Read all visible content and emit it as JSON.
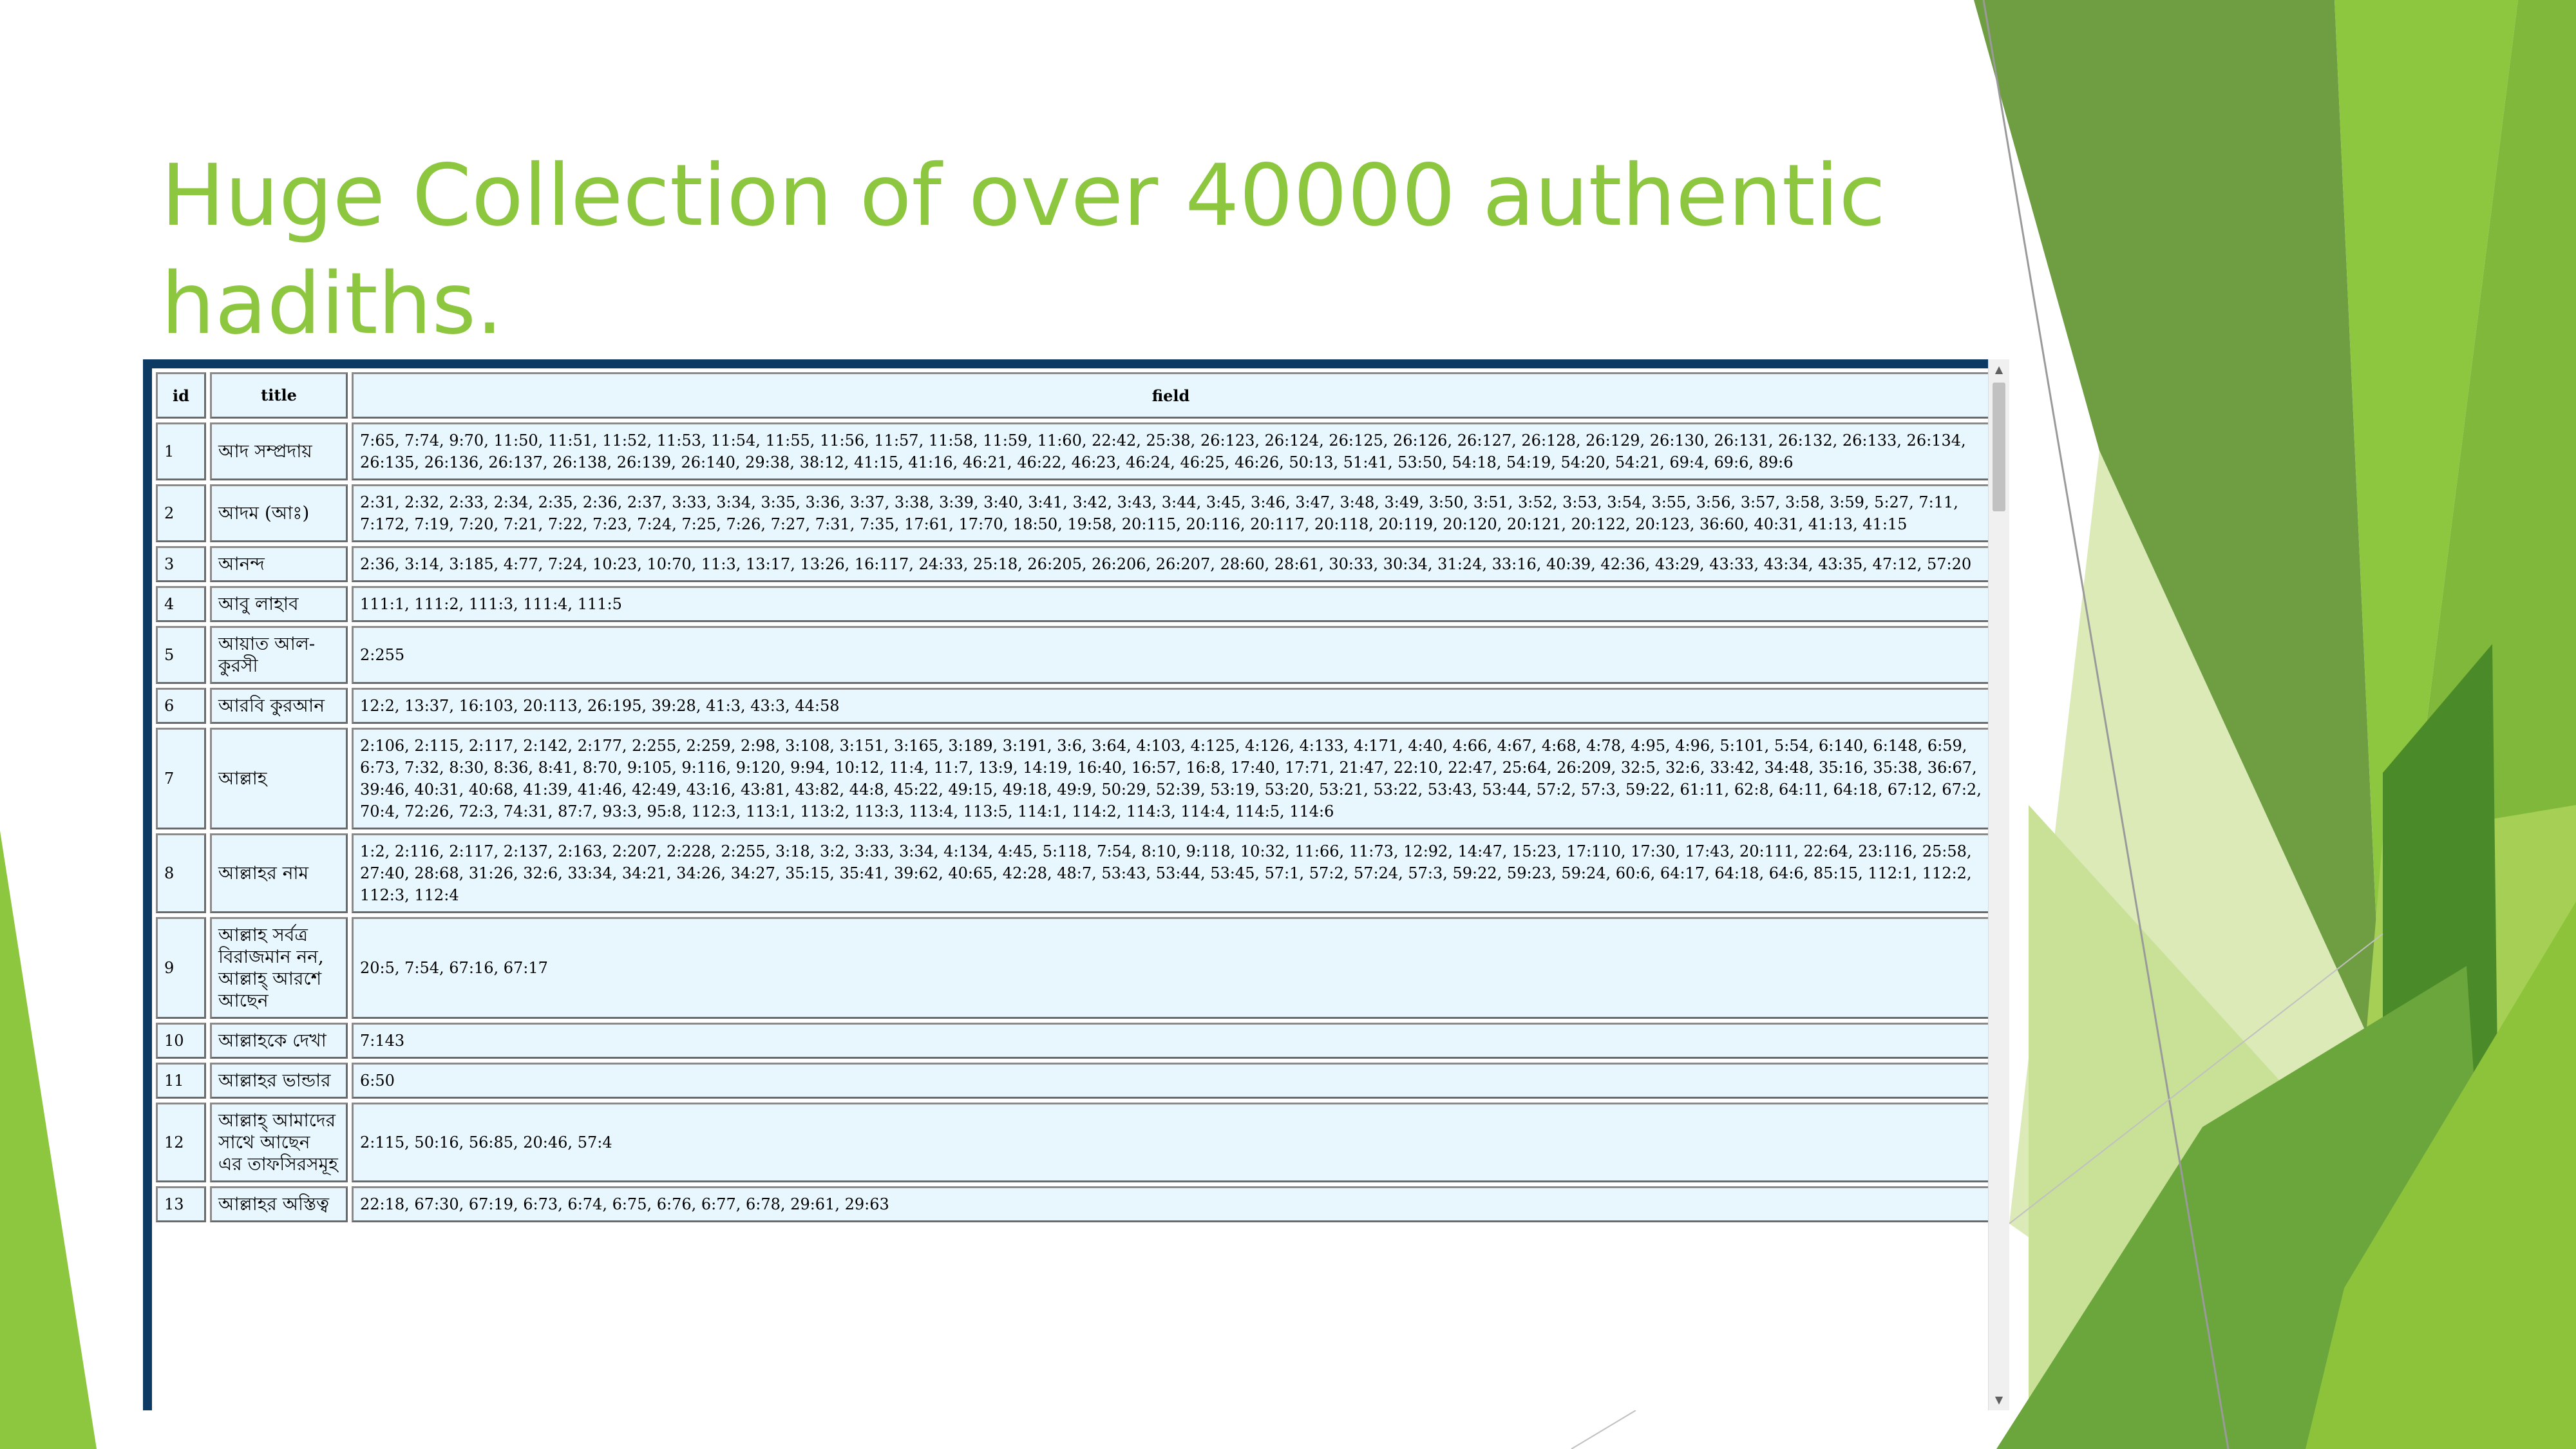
{
  "slide": {
    "title_line1": "Huge Collection of over 40000 authentic",
    "title_line2": "hadiths.",
    "accent_colors": [
      "#8dc63f",
      "#6fa53a",
      "#5e9233",
      "#dfeebf",
      "#a7cf5a"
    ]
  },
  "table": {
    "headers": {
      "id": "id",
      "title": "title",
      "field": "field"
    },
    "rows": [
      {
        "id": "1",
        "title": "আদ সম্প্রদায়",
        "field": "7:65, 7:74, 9:70, 11:50, 11:51, 11:52, 11:53, 11:54, 11:55, 11:56, 11:57, 11:58, 11:59, 11:60, 22:42, 25:38, 26:123, 26:124, 26:125, 26:126, 26:127, 26:128, 26:129, 26:130, 26:131, 26:132, 26:133, 26:134, 26:135, 26:136, 26:137, 26:138, 26:139, 26:140, 29:38, 38:12, 41:15, 41:16, 46:21, 46:22, 46:23, 46:24, 46:25, 46:26, 50:13, 51:41, 53:50, 54:18, 54:19, 54:20, 54:21, 69:4, 69:6, 89:6"
      },
      {
        "id": "2",
        "title": "আদম (আঃ)",
        "field": "2:31, 2:32, 2:33, 2:34, 2:35, 2:36, 2:37, 3:33, 3:34, 3:35, 3:36, 3:37, 3:38, 3:39, 3:40, 3:41, 3:42, 3:43, 3:44, 3:45, 3:46, 3:47, 3:48, 3:49, 3:50, 3:51, 3:52, 3:53, 3:54, 3:55, 3:56, 3:57, 3:58, 3:59, 5:27, 7:11, 7:172, 7:19, 7:20, 7:21, 7:22, 7:23, 7:24, 7:25, 7:26, 7:27, 7:31, 7:35, 17:61, 17:70, 18:50, 19:58, 20:115, 20:116, 20:117, 20:118, 20:119, 20:120, 20:121, 20:122, 20:123, 36:60, 40:31, 41:13, 41:15"
      },
      {
        "id": "3",
        "title": "আনন্দ",
        "field": "2:36, 3:14, 3:185, 4:77, 7:24, 10:23, 10:70, 11:3, 13:17, 13:26, 16:117, 24:33, 25:18, 26:205, 26:206, 26:207, 28:60, 28:61, 30:33, 30:34, 31:24, 33:16, 40:39, 42:36, 43:29, 43:33, 43:34, 43:35, 47:12, 57:20"
      },
      {
        "id": "4",
        "title": "আবু লাহাব",
        "field": "111:1, 111:2, 111:3, 111:4, 111:5"
      },
      {
        "id": "5",
        "title": "আয়াত আল-কুরসী",
        "field": "2:255"
      },
      {
        "id": "6",
        "title": "আরবি কুরআন",
        "field": "12:2, 13:37, 16:103, 20:113, 26:195, 39:28, 41:3, 43:3, 44:58"
      },
      {
        "id": "7",
        "title": "আল্লাহ",
        "field": "2:106, 2:115, 2:117, 2:142, 2:177, 2:255, 2:259, 2:98, 3:108, 3:151, 3:165, 3:189, 3:191, 3:6, 3:64, 4:103, 4:125, 4:126, 4:133, 4:171, 4:40, 4:66, 4:67, 4:68, 4:78, 4:95, 4:96, 5:101, 5:54, 6:140, 6:148, 6:59, 6:73, 7:32, 8:30, 8:36, 8:41, 8:70, 9:105, 9:116, 9:120, 9:94, 10:12, 11:4, 11:7, 13:9, 14:19, 16:40, 16:57, 16:8, 17:40, 17:71, 21:47, 22:10, 22:47, 25:64, 26:209, 32:5, 32:6, 33:42, 34:48, 35:16, 35:38, 36:67, 39:46, 40:31, 40:68, 41:39, 41:46, 42:49, 43:16, 43:81, 43:82, 44:8, 45:22, 49:15, 49:18, 49:9, 50:29, 52:39, 53:19, 53:20, 53:21, 53:22, 53:43, 53:44, 57:2, 57:3, 59:22, 61:11, 62:8, 64:11, 64:18, 67:12, 67:2, 70:4, 72:26, 72:3, 74:31, 87:7, 93:3, 95:8, 112:3, 113:1, 113:2, 113:3, 113:4, 113:5, 114:1, 114:2, 114:3, 114:4, 114:5, 114:6"
      },
      {
        "id": "8",
        "title": "আল্লাহর নাম",
        "field": "1:2, 2:116, 2:117, 2:137, 2:163, 2:207, 2:228, 2:255, 3:18, 3:2, 3:33, 3:34, 4:134, 4:45, 5:118, 7:54, 8:10, 9:118, 10:32, 11:66, 11:73, 12:92, 14:47, 15:23, 17:110, 17:30, 17:43, 20:111, 22:64, 23:116, 25:58, 27:40, 28:68, 31:26, 32:6, 33:34, 34:21, 34:26, 34:27, 35:15, 35:41, 39:62, 40:65, 42:28, 48:7, 53:43, 53:44, 53:45, 57:1, 57:2, 57:24, 57:3, 59:22, 59:23, 59:24, 60:6, 64:17, 64:18, 64:6, 85:15, 112:1, 112:2, 112:3, 112:4"
      },
      {
        "id": "9",
        "title": "আল্লাহ সর্বত্র বিরাজমান নন, আল্লাহ্ আরশে আছেন",
        "field": "20:5, 7:54, 67:16, 67:17"
      },
      {
        "id": "10",
        "title": "আল্লাহকে দেখা",
        "field": "7:143"
      },
      {
        "id": "11",
        "title": "আল্লাহর ভান্ডার",
        "field": "6:50"
      },
      {
        "id": "12",
        "title": "আল্লাহ্ আমাদের সাথে আছেন এর তাফসিরসমূহ",
        "field": "2:115, 50:16, 56:85, 20:46, 57:4"
      },
      {
        "id": "13",
        "title": "আল্লাহর অস্তিত্ব",
        "field": "22:18, 67:30, 67:19, 6:73, 6:74, 6:75, 6:76, 6:77, 6:78, 29:61, 29:63"
      }
    ]
  },
  "scrollbar": {
    "up_icon": "▲",
    "down_icon": "▼"
  }
}
